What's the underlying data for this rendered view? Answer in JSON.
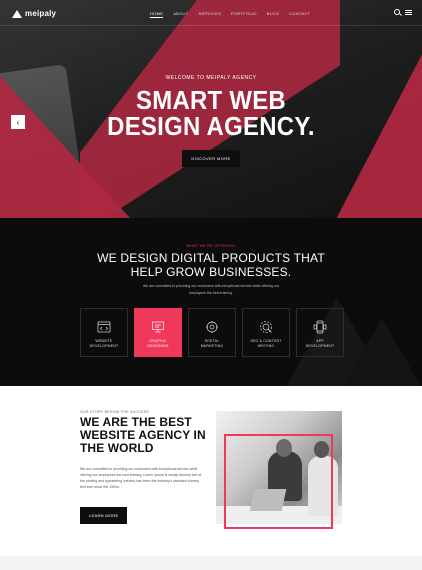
{
  "header": {
    "logo_text": "meipaly",
    "nav": [
      "HOME",
      "ABOUT",
      "SERVICES",
      "PORTFOLIO",
      "BLOG",
      "CONTACT"
    ],
    "active_nav": "HOME"
  },
  "hero": {
    "kicker": "WELCOME TO MEIPALY AGENCY",
    "title_line1": "SMART WEB",
    "title_line2": "DESIGN AGENCY.",
    "button": "DISCOVER MORE",
    "prev_arrow": "‹",
    "accent_color": "#f0385a"
  },
  "services": {
    "kicker": "WHAT WE'RE OFFERING",
    "title_line1": "WE DESIGN DIGITAL PRODUCTS THAT",
    "title_line2": "HELP GROW BUSINESSES.",
    "desc": "We are committed to providing our customers with exceptional service while offering our employees the best training.",
    "cards": [
      {
        "line1": "WEBSITE",
        "line2": "DEVELOPMENT",
        "icon": "code-window-icon",
        "active": false
      },
      {
        "line1": "GRAPHIC",
        "line2": "DESIGNING",
        "icon": "monitor-icon",
        "active": true
      },
      {
        "line1": "DIGITAL",
        "line2": "MARKETING",
        "icon": "megaphone-icon",
        "active": false
      },
      {
        "line1": "SEO & CONTENT",
        "line2": "WRITING",
        "icon": "seo-gear-icon",
        "active": false
      },
      {
        "line1": "APP",
        "line2": "DEVELOPMENT",
        "icon": "mobile-app-icon",
        "active": false
      }
    ]
  },
  "about": {
    "kicker": "OUR STORY BEHIND THE SUCCESS",
    "title_line1": "WE ARE THE BEST",
    "title_line2": "WEBSITE AGENCY IN",
    "title_line3": "THE WORLD",
    "desc": "We are committed to providing our customers with exceptional service while offering our employees the best training. Lorem Ipsum is simply dummy text of the printing and typesetting industry has been the industry's standard dummy text ever since the 1500s.",
    "button": "LEARN MORE"
  }
}
